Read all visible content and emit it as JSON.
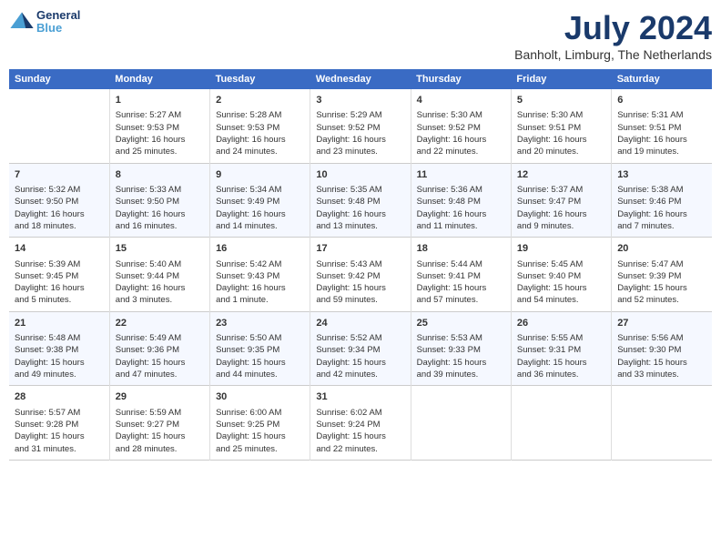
{
  "header": {
    "logo_line1": "General",
    "logo_line2": "Blue",
    "month": "July 2024",
    "location": "Banholt, Limburg, The Netherlands"
  },
  "days_of_week": [
    "Sunday",
    "Monday",
    "Tuesday",
    "Wednesday",
    "Thursday",
    "Friday",
    "Saturday"
  ],
  "weeks": [
    [
      {
        "day": "",
        "content": ""
      },
      {
        "day": "1",
        "content": "Sunrise: 5:27 AM\nSunset: 9:53 PM\nDaylight: 16 hours\nand 25 minutes."
      },
      {
        "day": "2",
        "content": "Sunrise: 5:28 AM\nSunset: 9:53 PM\nDaylight: 16 hours\nand 24 minutes."
      },
      {
        "day": "3",
        "content": "Sunrise: 5:29 AM\nSunset: 9:52 PM\nDaylight: 16 hours\nand 23 minutes."
      },
      {
        "day": "4",
        "content": "Sunrise: 5:30 AM\nSunset: 9:52 PM\nDaylight: 16 hours\nand 22 minutes."
      },
      {
        "day": "5",
        "content": "Sunrise: 5:30 AM\nSunset: 9:51 PM\nDaylight: 16 hours\nand 20 minutes."
      },
      {
        "day": "6",
        "content": "Sunrise: 5:31 AM\nSunset: 9:51 PM\nDaylight: 16 hours\nand 19 minutes."
      }
    ],
    [
      {
        "day": "7",
        "content": "Sunrise: 5:32 AM\nSunset: 9:50 PM\nDaylight: 16 hours\nand 18 minutes."
      },
      {
        "day": "8",
        "content": "Sunrise: 5:33 AM\nSunset: 9:50 PM\nDaylight: 16 hours\nand 16 minutes."
      },
      {
        "day": "9",
        "content": "Sunrise: 5:34 AM\nSunset: 9:49 PM\nDaylight: 16 hours\nand 14 minutes."
      },
      {
        "day": "10",
        "content": "Sunrise: 5:35 AM\nSunset: 9:48 PM\nDaylight: 16 hours\nand 13 minutes."
      },
      {
        "day": "11",
        "content": "Sunrise: 5:36 AM\nSunset: 9:48 PM\nDaylight: 16 hours\nand 11 minutes."
      },
      {
        "day": "12",
        "content": "Sunrise: 5:37 AM\nSunset: 9:47 PM\nDaylight: 16 hours\nand 9 minutes."
      },
      {
        "day": "13",
        "content": "Sunrise: 5:38 AM\nSunset: 9:46 PM\nDaylight: 16 hours\nand 7 minutes."
      }
    ],
    [
      {
        "day": "14",
        "content": "Sunrise: 5:39 AM\nSunset: 9:45 PM\nDaylight: 16 hours\nand 5 minutes."
      },
      {
        "day": "15",
        "content": "Sunrise: 5:40 AM\nSunset: 9:44 PM\nDaylight: 16 hours\nand 3 minutes."
      },
      {
        "day": "16",
        "content": "Sunrise: 5:42 AM\nSunset: 9:43 PM\nDaylight: 16 hours\nand 1 minute."
      },
      {
        "day": "17",
        "content": "Sunrise: 5:43 AM\nSunset: 9:42 PM\nDaylight: 15 hours\nand 59 minutes."
      },
      {
        "day": "18",
        "content": "Sunrise: 5:44 AM\nSunset: 9:41 PM\nDaylight: 15 hours\nand 57 minutes."
      },
      {
        "day": "19",
        "content": "Sunrise: 5:45 AM\nSunset: 9:40 PM\nDaylight: 15 hours\nand 54 minutes."
      },
      {
        "day": "20",
        "content": "Sunrise: 5:47 AM\nSunset: 9:39 PM\nDaylight: 15 hours\nand 52 minutes."
      }
    ],
    [
      {
        "day": "21",
        "content": "Sunrise: 5:48 AM\nSunset: 9:38 PM\nDaylight: 15 hours\nand 49 minutes."
      },
      {
        "day": "22",
        "content": "Sunrise: 5:49 AM\nSunset: 9:36 PM\nDaylight: 15 hours\nand 47 minutes."
      },
      {
        "day": "23",
        "content": "Sunrise: 5:50 AM\nSunset: 9:35 PM\nDaylight: 15 hours\nand 44 minutes."
      },
      {
        "day": "24",
        "content": "Sunrise: 5:52 AM\nSunset: 9:34 PM\nDaylight: 15 hours\nand 42 minutes."
      },
      {
        "day": "25",
        "content": "Sunrise: 5:53 AM\nSunset: 9:33 PM\nDaylight: 15 hours\nand 39 minutes."
      },
      {
        "day": "26",
        "content": "Sunrise: 5:55 AM\nSunset: 9:31 PM\nDaylight: 15 hours\nand 36 minutes."
      },
      {
        "day": "27",
        "content": "Sunrise: 5:56 AM\nSunset: 9:30 PM\nDaylight: 15 hours\nand 33 minutes."
      }
    ],
    [
      {
        "day": "28",
        "content": "Sunrise: 5:57 AM\nSunset: 9:28 PM\nDaylight: 15 hours\nand 31 minutes."
      },
      {
        "day": "29",
        "content": "Sunrise: 5:59 AM\nSunset: 9:27 PM\nDaylight: 15 hours\nand 28 minutes."
      },
      {
        "day": "30",
        "content": "Sunrise: 6:00 AM\nSunset: 9:25 PM\nDaylight: 15 hours\nand 25 minutes."
      },
      {
        "day": "31",
        "content": "Sunrise: 6:02 AM\nSunset: 9:24 PM\nDaylight: 15 hours\nand 22 minutes."
      },
      {
        "day": "",
        "content": ""
      },
      {
        "day": "",
        "content": ""
      },
      {
        "day": "",
        "content": ""
      }
    ]
  ]
}
